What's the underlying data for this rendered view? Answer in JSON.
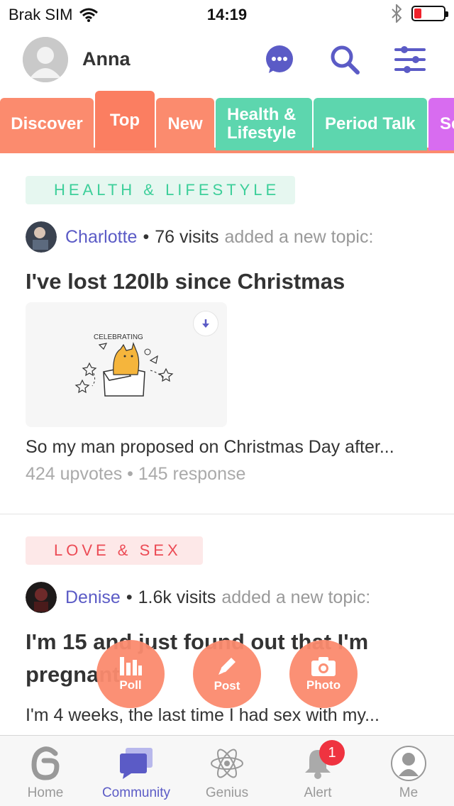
{
  "status_bar": {
    "carrier": "Brak SIM",
    "time": "14:19",
    "battery_color": "#f0222b"
  },
  "header": {
    "user_name": "Anna"
  },
  "tabs": [
    {
      "label": "Discover"
    },
    {
      "label": "Top"
    },
    {
      "label": "New"
    },
    {
      "label": "Health & Lifestyle"
    },
    {
      "label": "Period Talk"
    },
    {
      "label": "Se Re"
    }
  ],
  "feed": {
    "posts": [
      {
        "category": "HEALTH & LIFESTYLE",
        "author": "Charlotte",
        "visits": "76 visits",
        "action": "added a new topic:",
        "title": "I've lost 120lb since Christmas",
        "image_caption": "CELEBRATING",
        "excerpt": "So my man proposed on Christmas Day after...",
        "upvotes": "424 upvotes",
        "responses": "145 response"
      },
      {
        "category": "LOVE & SEX",
        "author": "Denise",
        "visits": "1.6k visits",
        "action": "added a new topic:",
        "title": "I'm 15 and just found out that I'm pregnant",
        "excerpt": "I'm 4 weeks, the last time I had sex with my..."
      }
    ]
  },
  "fabs": {
    "poll": "Poll",
    "post": "Post",
    "photo": "Photo"
  },
  "bottom_nav": {
    "home": "Home",
    "community": "Community",
    "genius": "Genius",
    "alert": "Alert",
    "alert_badge": "1",
    "me": "Me"
  },
  "colors": {
    "accent_orange": "#fb8b6e",
    "accent_green": "#5dd6ae",
    "accent_purple": "#5b5bc6",
    "badge_red": "#ef3340"
  }
}
